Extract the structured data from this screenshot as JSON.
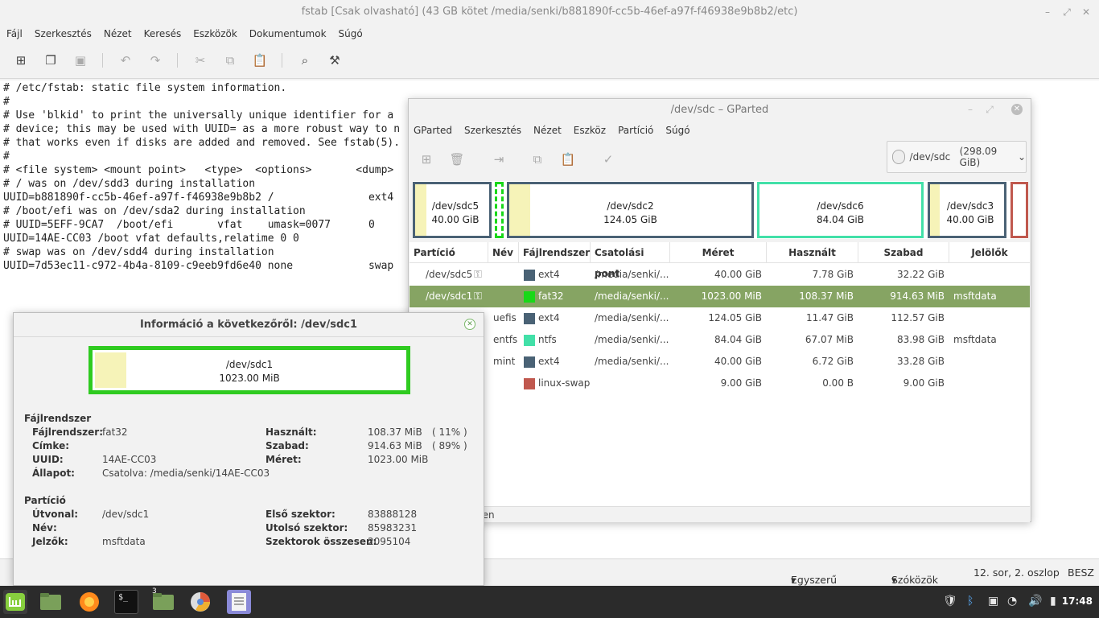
{
  "editor": {
    "title": "fstab [Csak olvasható] (43 GB kötet /media/senki/b881890f-cc5b-46ef-a97f-f46938e9b8b2/etc)",
    "menu": [
      "Fájl",
      "Szerkesztés",
      "Nézet",
      "Keresés",
      "Eszközök",
      "Dokumentumok",
      "Súgó"
    ],
    "lines": [
      "# /etc/fstab: static file system information.",
      "#",
      "# Use 'blkid' to print the universally unique identifier for a",
      "# device; this may be used with UUID= as a more robust way to n",
      "# that works even if disks are added and removed. See fstab(5).",
      "#",
      "# <file system> <mount point>   <type>  <options>       <dump>",
      "# / was on /dev/sdd3 during installation",
      "UUID=b881890f-cc5b-46ef-a97f-f46938e9b8b2 /               ext4",
      "# /boot/efi was on /dev/sda2 during installation",
      "# UUID=5EFF-9CA7  /boot/efi       vfat    umask=0077      0",
      "UUID=14AE-CC03 /boot vfat defaults,relatime 0 0",
      "# swap was on /dev/sdd4 during installation",
      "UUID=7d53ec11-c972-4b4a-8109-c9eeb9fd6e40 none            swap"
    ],
    "status": {
      "language": "Egyszerű szöveg",
      "indent": "Szóközök",
      "position": "12. sor, 2. oszlop",
      "mode": "BESZ"
    }
  },
  "gparted": {
    "title": "/dev/sdc – GParted",
    "menu": [
      "GParted",
      "Szerkesztés",
      "Nézet",
      "Eszköz",
      "Partíció",
      "Súgó"
    ],
    "device": {
      "name": "/dev/sdc",
      "size": "(298.09 GiB)"
    },
    "graph": [
      {
        "name": "/dev/sdc5",
        "size": "40.00 GiB"
      },
      {
        "name": "/dev/sdc2",
        "size": "124.05 GiB"
      },
      {
        "name": "/dev/sdc6",
        "size": "84.04 GiB"
      },
      {
        "name": "/dev/sdc3",
        "size": "40.00 GiB"
      }
    ],
    "columns": [
      "Partíció",
      "Név",
      "Fájlrendszer",
      "Csatolási pont",
      "Méret",
      "Használt",
      "Szabad",
      "Jelölők"
    ],
    "rows": [
      {
        "partition": "/dev/sdc5",
        "name": "",
        "fs": "ext4",
        "mount": "/media/senki/...",
        "size": "40.00 GiB",
        "used": "7.78 GiB",
        "free": "32.22 GiB",
        "flags": "",
        "color": "#4a6275"
      },
      {
        "partition": "/dev/sdc1",
        "name": "",
        "fs": "fat32",
        "mount": "/media/senki/...",
        "size": "1023.00 MiB",
        "used": "108.37 MiB",
        "free": "914.63 MiB",
        "flags": "msftdata",
        "color": "#18d818"
      },
      {
        "partition": "",
        "name": "uefis",
        "fs": "ext4",
        "mount": "/media/senki/...",
        "size": "124.05 GiB",
        "used": "11.47 GiB",
        "free": "112.57 GiB",
        "flags": "",
        "color": "#4a6275"
      },
      {
        "partition": "",
        "name": "entfs",
        "fs": "ntfs",
        "mount": "/media/senki/...",
        "size": "84.04 GiB",
        "used": "67.07 MiB",
        "free": "83.98 GiB",
        "flags": "msftdata",
        "color": "#42e0a8"
      },
      {
        "partition": "",
        "name": "mint",
        "fs": "ext4",
        "mount": "/media/senki/...",
        "size": "40.00 GiB",
        "used": "6.72 GiB",
        "free": "33.28 GiB",
        "flags": "",
        "color": "#4a6275"
      },
      {
        "partition": "",
        "name": "",
        "fs": "linux-swap",
        "mount": "",
        "size": "9.00 GiB",
        "used": "0.00 B",
        "free": "9.00 GiB",
        "flags": "",
        "color": "#c0584e"
      }
    ],
    "status": "ben"
  },
  "info": {
    "title": "Információ a következőről: /dev/sdc1",
    "graph": {
      "name": "/dev/sdc1",
      "size": "1023.00 MiB"
    },
    "fs_section": "Fájlrendszer",
    "fs_fields": [
      {
        "key": "Fájlrendszer:",
        "value": "fat32"
      },
      {
        "key": "Címke:",
        "value": ""
      },
      {
        "key": "UUID:",
        "value": "14AE-CC03"
      },
      {
        "key": "Állapot:",
        "value": "Csatolva: /media/senki/14AE-CC03"
      }
    ],
    "usage_fields": [
      {
        "key": "Használt:",
        "value": "108.37 MiB",
        "pct": "( 11% )"
      },
      {
        "key": "Szabad:",
        "value": "914.63 MiB",
        "pct": "( 89% )"
      },
      {
        "key": "Méret:",
        "value": "1023.00 MiB",
        "pct": ""
      }
    ],
    "part_section": "Partíció",
    "part_fields": [
      {
        "key": "Útvonal:",
        "value": "/dev/sdc1"
      },
      {
        "key": "Név:",
        "value": ""
      },
      {
        "key": "Jelzők:",
        "value": "msftdata"
      }
    ],
    "sector_fields": [
      {
        "key": "Első szektor:",
        "value": "83888128"
      },
      {
        "key": "Utolsó szektor:",
        "value": "85983231"
      },
      {
        "key": "Szektorok összesen:",
        "value": "2095104"
      }
    ]
  },
  "taskbar": {
    "clock": "17:48",
    "badge": "3"
  }
}
